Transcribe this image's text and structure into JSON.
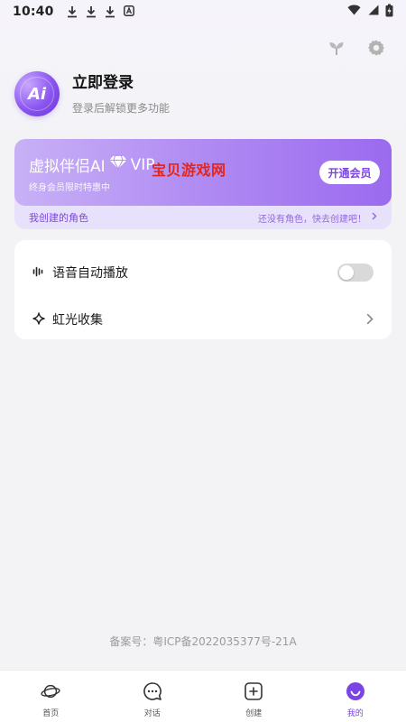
{
  "status_bar": {
    "time": "10:40",
    "left_icons": [
      "download-icon",
      "download-icon",
      "download-icon",
      "a-notification-icon"
    ],
    "right_icons": [
      "wifi-icon",
      "signal-icon",
      "battery-charging-icon"
    ]
  },
  "top_actions": [
    "sprout-icon",
    "gear-icon"
  ],
  "profile": {
    "avatar_text": "Ai",
    "title": "立即登录",
    "subtitle": "登录后解锁更多功能"
  },
  "vip": {
    "title": "虚拟伴侣AI",
    "vip_text": "VIP",
    "subtitle": "终身会员限时特惠中",
    "watermark": "宝贝游戏网",
    "button": "开通会员",
    "roles_label": "我创建的角色",
    "roles_hint": "还没有角色，快去创建吧！"
  },
  "settings": [
    {
      "icon": "sound-wave-icon",
      "label": "语音自动播放",
      "control": "toggle",
      "enabled": false
    },
    {
      "icon": "sparkle-icon",
      "label": "虹光收集",
      "control": "chevron"
    }
  ],
  "icp": "备案号：粤ICP备2022035377号-21A",
  "colors": {
    "accent": "#7b45e3",
    "vip_gradient_start": "#c8b1f6",
    "vip_gradient_end": "#9b6aef",
    "watermark": "#e5261b"
  },
  "bottom_nav": [
    {
      "icon": "planet-icon",
      "label": "首页",
      "active": false
    },
    {
      "icon": "chat-bubble-icon",
      "label": "对话",
      "active": false
    },
    {
      "icon": "add-square-icon",
      "label": "创建",
      "active": false
    },
    {
      "icon": "smile-face-icon",
      "label": "我的",
      "active": true
    }
  ]
}
